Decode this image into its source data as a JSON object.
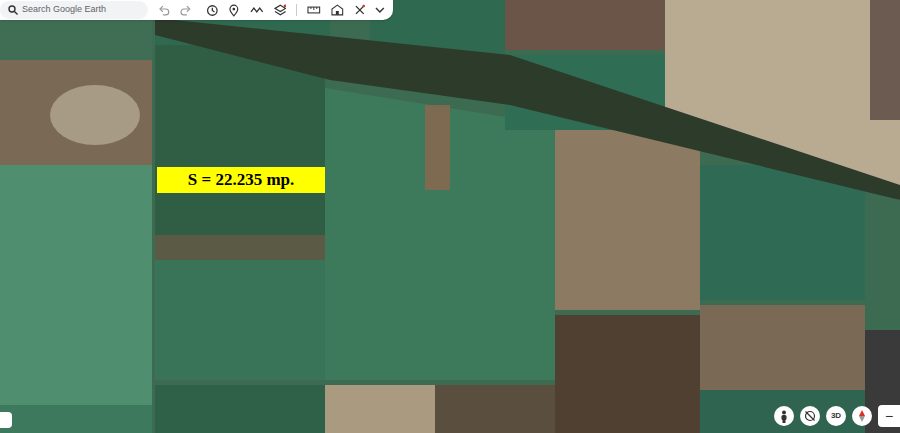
{
  "search": {
    "placeholder": "Search Google Earth"
  },
  "map": {
    "label": "S = 22.235 mp."
  },
  "controls": {
    "view_3d": "3D",
    "zoom_out": "−"
  }
}
